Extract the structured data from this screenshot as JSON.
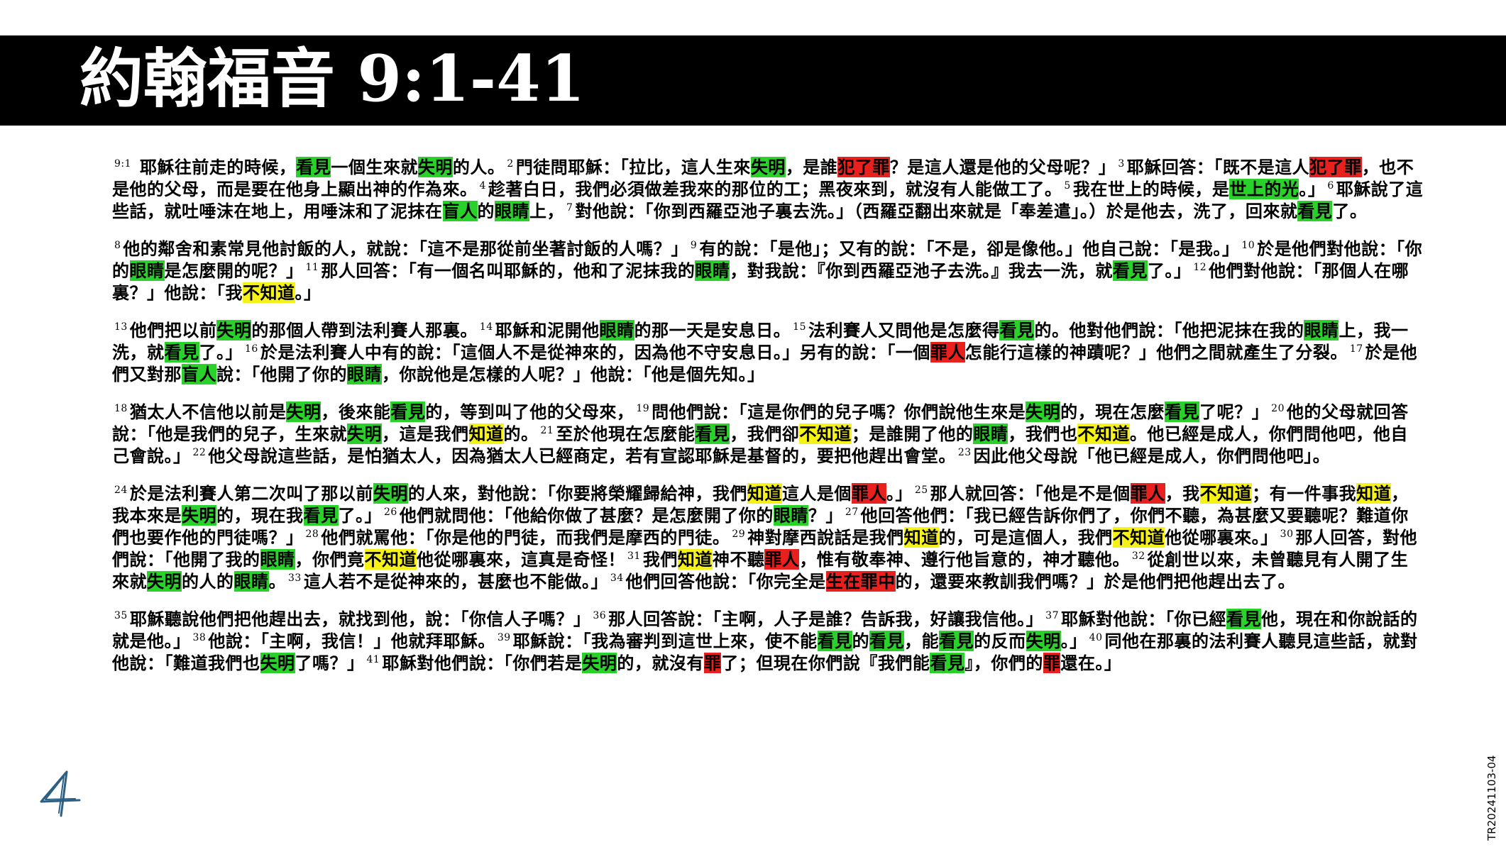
{
  "header": {
    "title": "約翰福音  9:1-41"
  },
  "page_number": "4",
  "doc_code": "TR20241103-04",
  "highlight_colors": {
    "green": "#2bd12b",
    "red": "#e8201e",
    "yellow": "#f6f218"
  },
  "paragraphs": [
    [
      {
        "t": "9:1",
        "v": 1
      },
      {
        "t": " 耶穌往前走的時候，"
      },
      {
        "t": "看見",
        "h": "g"
      },
      {
        "t": "一個生來就"
      },
      {
        "t": "失明",
        "h": "g"
      },
      {
        "t": "的人。"
      },
      {
        "t": "2",
        "v": 1
      },
      {
        "t": "門徒問耶穌：「拉比，這人生來"
      },
      {
        "t": "失明",
        "h": "g"
      },
      {
        "t": "，是誰"
      },
      {
        "t": "犯了罪",
        "h": "r"
      },
      {
        "t": "？是這人還是他的父母呢？」"
      },
      {
        "t": "3",
        "v": 1
      },
      {
        "t": "耶穌回答：「既不是這人"
      },
      {
        "t": "犯了罪",
        "h": "r"
      },
      {
        "t": "，也不是他的父母，而是要在他身上顯出神的作為來。"
      },
      {
        "t": "4",
        "v": 1
      },
      {
        "t": "趁著白日，我們必須做差我來的那位的工；黑夜來到，就沒有人能做工了。"
      },
      {
        "t": "5",
        "v": 1
      },
      {
        "t": "我在世上的時候，是"
      },
      {
        "t": "世上的光",
        "h": "g"
      },
      {
        "t": "。」"
      },
      {
        "t": "6",
        "v": 1
      },
      {
        "t": "耶穌說了這些話，就吐唾沫在地上，用唾沫和了泥抹在"
      },
      {
        "t": "盲人",
        "h": "g"
      },
      {
        "t": "的"
      },
      {
        "t": "眼睛",
        "h": "g"
      },
      {
        "t": "上，"
      },
      {
        "t": "7",
        "v": 1
      },
      {
        "t": "對他說：「你到西羅亞池子裏去洗。」（西羅亞翻出來就是「奉差遣」。）於是他去，洗了，回來就"
      },
      {
        "t": "看見",
        "h": "g"
      },
      {
        "t": "了。"
      }
    ],
    [
      {
        "t": "8",
        "v": 1
      },
      {
        "t": "他的鄰舍和素常見他討飯的人，就說：「這不是那從前坐著討飯的人嗎？」"
      },
      {
        "t": "9",
        "v": 1
      },
      {
        "t": "有的說：「是他」；又有的說：「不是，卻是像他。」他自己說：「是我。」"
      },
      {
        "t": "10",
        "v": 1
      },
      {
        "t": "於是他們對他說：「你的"
      },
      {
        "t": "眼睛",
        "h": "g"
      },
      {
        "t": "是怎麼開的呢？」"
      },
      {
        "t": "11",
        "v": 1
      },
      {
        "t": "那人回答：「有一個名叫耶穌的，他和了泥抹我的"
      },
      {
        "t": "眼睛",
        "h": "g"
      },
      {
        "t": "，對我說：『你到西羅亞池子去洗。』我去一洗，就"
      },
      {
        "t": "看見",
        "h": "g"
      },
      {
        "t": "了。」"
      },
      {
        "t": "12",
        "v": 1
      },
      {
        "t": "他們對他說：「那個人在哪裏？」他說：「我"
      },
      {
        "t": "不知道",
        "h": "y"
      },
      {
        "t": "。」"
      }
    ],
    [
      {
        "t": "13",
        "v": 1
      },
      {
        "t": "他們把以前"
      },
      {
        "t": "失明",
        "h": "g"
      },
      {
        "t": "的那個人帶到法利賽人那裏。"
      },
      {
        "t": "14",
        "v": 1
      },
      {
        "t": "耶穌和泥開他"
      },
      {
        "t": "眼睛",
        "h": "g"
      },
      {
        "t": "的那一天是安息日。"
      },
      {
        "t": "15",
        "v": 1
      },
      {
        "t": "法利賽人又問他是怎麼得"
      },
      {
        "t": "看見",
        "h": "g"
      },
      {
        "t": "的。他對他們說：「他把泥抹在我的"
      },
      {
        "t": "眼睛",
        "h": "g"
      },
      {
        "t": "上，我一洗，就"
      },
      {
        "t": "看見",
        "h": "g"
      },
      {
        "t": "了。」"
      },
      {
        "t": "16",
        "v": 1
      },
      {
        "t": "於是法利賽人中有的說：「這個人不是從神來的，因為他不守安息日。」另有的說：「一個"
      },
      {
        "t": "罪人",
        "h": "r"
      },
      {
        "t": "怎能行這樣的神蹟呢？」他們之間就產生了分裂。"
      },
      {
        "t": "17",
        "v": 1
      },
      {
        "t": "於是他們又對那"
      },
      {
        "t": "盲人",
        "h": "g"
      },
      {
        "t": "說：「他開了你的"
      },
      {
        "t": "眼睛",
        "h": "g"
      },
      {
        "t": "，你說他是怎樣的人呢？」他說：「他是個先知。」"
      }
    ],
    [
      {
        "t": "18",
        "v": 1
      },
      {
        "t": "猶太人不信他以前是"
      },
      {
        "t": "失明",
        "h": "g"
      },
      {
        "t": "，後來能"
      },
      {
        "t": "看見",
        "h": "g"
      },
      {
        "t": "的，等到叫了他的父母來，"
      },
      {
        "t": "19",
        "v": 1
      },
      {
        "t": "問他們說：「這是你們的兒子嗎？你們說他生來是"
      },
      {
        "t": "失明",
        "h": "g"
      },
      {
        "t": "的，現在怎麼"
      },
      {
        "t": "看見",
        "h": "g"
      },
      {
        "t": "了呢？」"
      },
      {
        "t": "20",
        "v": 1
      },
      {
        "t": "他的父母就回答說：「他是我們的兒子，生來就"
      },
      {
        "t": "失明",
        "h": "g"
      },
      {
        "t": "，這是我們"
      },
      {
        "t": "知道",
        "h": "y"
      },
      {
        "t": "的。"
      },
      {
        "t": "21",
        "v": 1
      },
      {
        "t": "至於他現在怎麼能"
      },
      {
        "t": "看見",
        "h": "g"
      },
      {
        "t": "，我們卻"
      },
      {
        "t": "不知道",
        "h": "y"
      },
      {
        "t": "；是誰開了他的"
      },
      {
        "t": "眼睛",
        "h": "g"
      },
      {
        "t": "，我們也"
      },
      {
        "t": "不知道",
        "h": "y"
      },
      {
        "t": "。他已經是成人，你們問他吧，他自己會說。」"
      },
      {
        "t": "22",
        "v": 1
      },
      {
        "t": "他父母說這些話，是怕猶太人，因為猶太人已經商定，若有宣認耶穌是基督的，要把他趕出會堂。"
      },
      {
        "t": "23",
        "v": 1
      },
      {
        "t": "因此他父母說「他已經是成人，你們問他吧」。"
      }
    ],
    [
      {
        "t": "24",
        "v": 1
      },
      {
        "t": "於是法利賽人第二次叫了那以前"
      },
      {
        "t": "失明",
        "h": "g"
      },
      {
        "t": "的人來，對他說：「你要將榮耀歸給神，我們"
      },
      {
        "t": "知道",
        "h": "y"
      },
      {
        "t": "這人是個"
      },
      {
        "t": "罪人",
        "h": "r"
      },
      {
        "t": "。」"
      },
      {
        "t": "25",
        "v": 1
      },
      {
        "t": "那人就回答：「他是不是個"
      },
      {
        "t": "罪人",
        "h": "r"
      },
      {
        "t": "，我"
      },
      {
        "t": "不知道",
        "h": "y"
      },
      {
        "t": "；有一件事我"
      },
      {
        "t": "知道",
        "h": "y"
      },
      {
        "t": "，我本來是"
      },
      {
        "t": "失明",
        "h": "g"
      },
      {
        "t": "的，現在我"
      },
      {
        "t": "看見",
        "h": "g"
      },
      {
        "t": "了。」"
      },
      {
        "t": "26",
        "v": 1
      },
      {
        "t": "他們就問他：「他給你做了甚麼？是怎麼開了你的"
      },
      {
        "t": "眼睛",
        "h": "g"
      },
      {
        "t": "？」"
      },
      {
        "t": "27",
        "v": 1
      },
      {
        "t": "他回答他們：「我已經告訴你們了，你們不聽，為甚麼又要聽呢？難道你們也要作他的門徒嗎？」"
      },
      {
        "t": "28",
        "v": 1
      },
      {
        "t": "他們就罵他：「你是他的門徒，而我們是摩西的門徒。"
      },
      {
        "t": "29",
        "v": 1
      },
      {
        "t": "神對摩西說話是我們"
      },
      {
        "t": "知道",
        "h": "y"
      },
      {
        "t": "的，可是這個人，我們"
      },
      {
        "t": "不知道",
        "h": "y"
      },
      {
        "t": "他從哪裏來。」"
      },
      {
        "t": "30",
        "v": 1
      },
      {
        "t": "那人回答，對他們說：「他開了我的"
      },
      {
        "t": "眼睛",
        "h": "g"
      },
      {
        "t": "，你們竟"
      },
      {
        "t": "不知道",
        "h": "y"
      },
      {
        "t": "他從哪裏來，這真是奇怪！"
      },
      {
        "t": "31",
        "v": 1
      },
      {
        "t": "我們"
      },
      {
        "t": "知道",
        "h": "y"
      },
      {
        "t": "神不聽"
      },
      {
        "t": "罪人",
        "h": "r"
      },
      {
        "t": "，惟有敬奉神、遵行他旨意的，神才聽他。"
      },
      {
        "t": "32",
        "v": 1
      },
      {
        "t": "從創世以來，未曾聽見有人開了生來就"
      },
      {
        "t": "失明",
        "h": "g"
      },
      {
        "t": "的人的"
      },
      {
        "t": "眼睛",
        "h": "g"
      },
      {
        "t": "。"
      },
      {
        "t": "33",
        "v": 1
      },
      {
        "t": "這人若不是從神來的，甚麼也不能做。」"
      },
      {
        "t": "34",
        "v": 1
      },
      {
        "t": "他們回答他說：「你完全是"
      },
      {
        "t": "生在罪中",
        "h": "r"
      },
      {
        "t": "的，還要來教訓我們嗎？」於是他們把他趕出去了。"
      }
    ],
    [
      {
        "t": "35",
        "v": 1
      },
      {
        "t": "耶穌聽說他們把他趕出去，就找到他，說：「你信人子嗎？」"
      },
      {
        "t": "36",
        "v": 1
      },
      {
        "t": "那人回答說：「主啊，人子是誰？告訴我，好讓我信他。」"
      },
      {
        "t": "37",
        "v": 1
      },
      {
        "t": "耶穌對他說：「你已經"
      },
      {
        "t": "看見",
        "h": "g"
      },
      {
        "t": "他，現在和你說話的就是他。」"
      },
      {
        "t": "38",
        "v": 1
      },
      {
        "t": "他說：「主啊，我信！」他就拜耶穌。"
      },
      {
        "t": "39",
        "v": 1
      },
      {
        "t": "耶穌說：「我為審判到這世上來，使不能"
      },
      {
        "t": "看見",
        "h": "g"
      },
      {
        "t": "的"
      },
      {
        "t": "看見",
        "h": "g"
      },
      {
        "t": "，能"
      },
      {
        "t": "看見",
        "h": "g"
      },
      {
        "t": "的反而"
      },
      {
        "t": "失明",
        "h": "g"
      },
      {
        "t": "。」"
      },
      {
        "t": "40",
        "v": 1
      },
      {
        "t": "同他在那裏的法利賽人聽見這些話，就對他說：「難道我們也"
      },
      {
        "t": "失明",
        "h": "g"
      },
      {
        "t": "了嗎？」"
      },
      {
        "t": "41",
        "v": 1
      },
      {
        "t": "耶穌對他們說：「你們若是"
      },
      {
        "t": "失明",
        "h": "g"
      },
      {
        "t": "的，就沒有"
      },
      {
        "t": "罪",
        "h": "r"
      },
      {
        "t": "了；但現在你們說『我們能"
      },
      {
        "t": "看見",
        "h": "g"
      },
      {
        "t": "』，你們的"
      },
      {
        "t": "罪",
        "h": "r"
      },
      {
        "t": "還在。」"
      }
    ]
  ]
}
